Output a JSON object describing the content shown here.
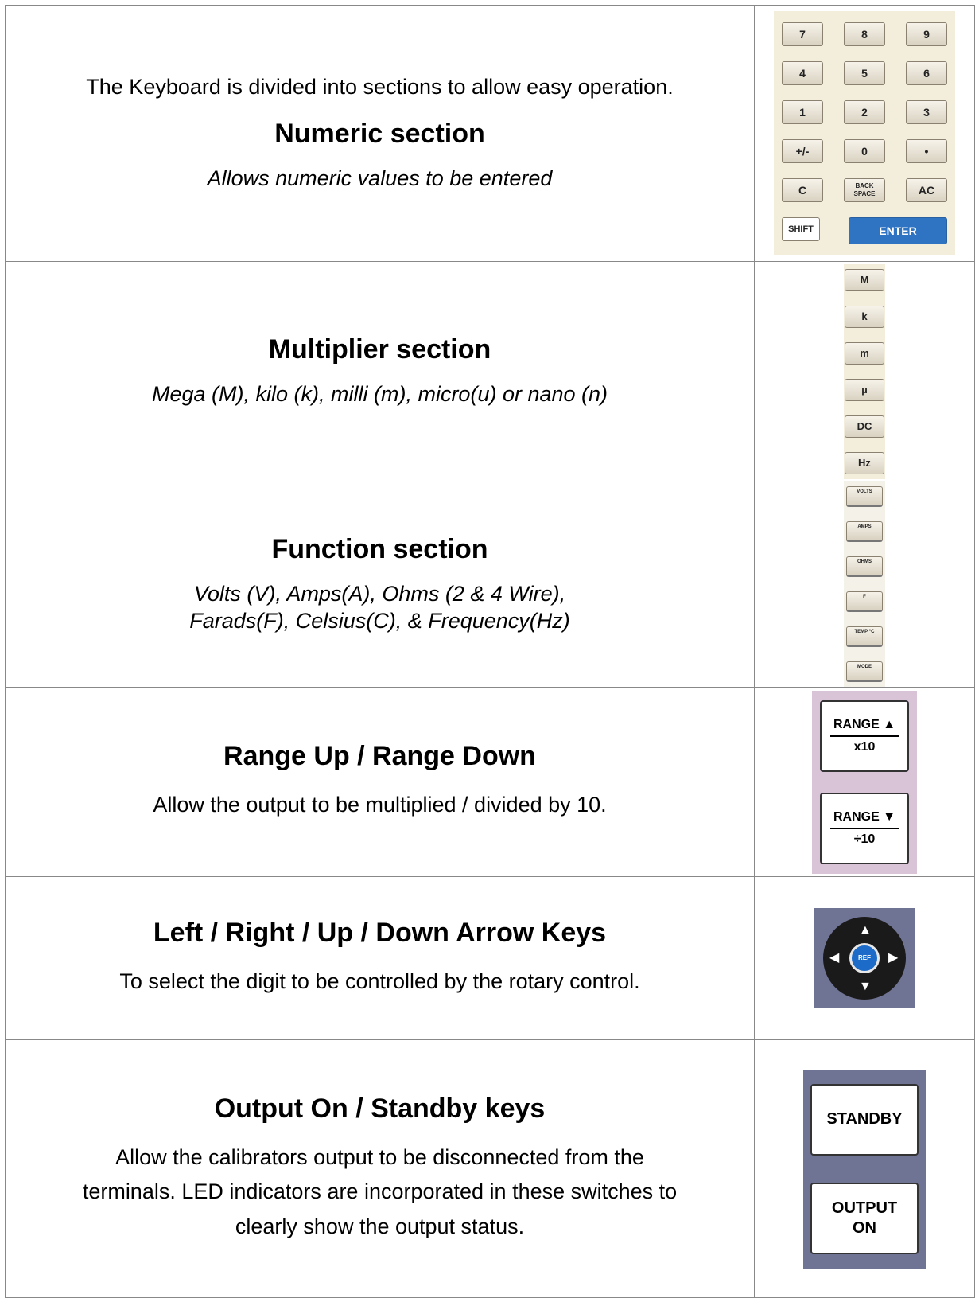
{
  "rows": {
    "numeric": {
      "intro": "The Keyboard is divided into sections to allow easy operation.",
      "heading": "Numeric section",
      "desc": "Allows numeric values to be entered",
      "keys": [
        "7",
        "8",
        "9",
        "4",
        "5",
        "6",
        "1",
        "2",
        "3",
        "+/-",
        "0",
        "•",
        "C",
        "BACK SPACE",
        "AC"
      ],
      "shift": "SHIFT",
      "enter": "ENTER"
    },
    "multiplier": {
      "heading": "Multiplier section",
      "desc": "Mega (M), kilo (k), milli (m), micro(u) or nano (n)",
      "keys": [
        "M",
        "k",
        "m",
        "µ",
        "DC",
        "Hz"
      ]
    },
    "function": {
      "heading": "Function section",
      "desc1": "Volts (V), Amps(A), Ohms (2 & 4 Wire),",
      "desc2": "Farads(F), Celsius(C), & Frequency(Hz)",
      "keys": [
        "VOLTS",
        "AMPS",
        "OHMS",
        "F",
        "TEMP °C",
        "MODE"
      ]
    },
    "range": {
      "heading": "Range Up / Range Down",
      "desc": "Allow the output to be multiplied / divided by 10.",
      "up_top": "RANGE ▲",
      "up_bot": "x10",
      "down_top": "RANGE ▼",
      "down_bot": "÷10"
    },
    "arrows": {
      "heading": "Left / Right / Up / Down Arrow Keys",
      "desc": "To select the digit to be controlled by the rotary control.",
      "center": "REF"
    },
    "output": {
      "heading": "Output On / Standby keys",
      "desc1": "Allow the calibrators output to be disconnected from the",
      "desc2": "terminals. LED indicators are incorporated in these switches to",
      "desc3": "clearly show the output status.",
      "standby": "STANDBY",
      "output_on": "OUTPUT ON"
    }
  }
}
